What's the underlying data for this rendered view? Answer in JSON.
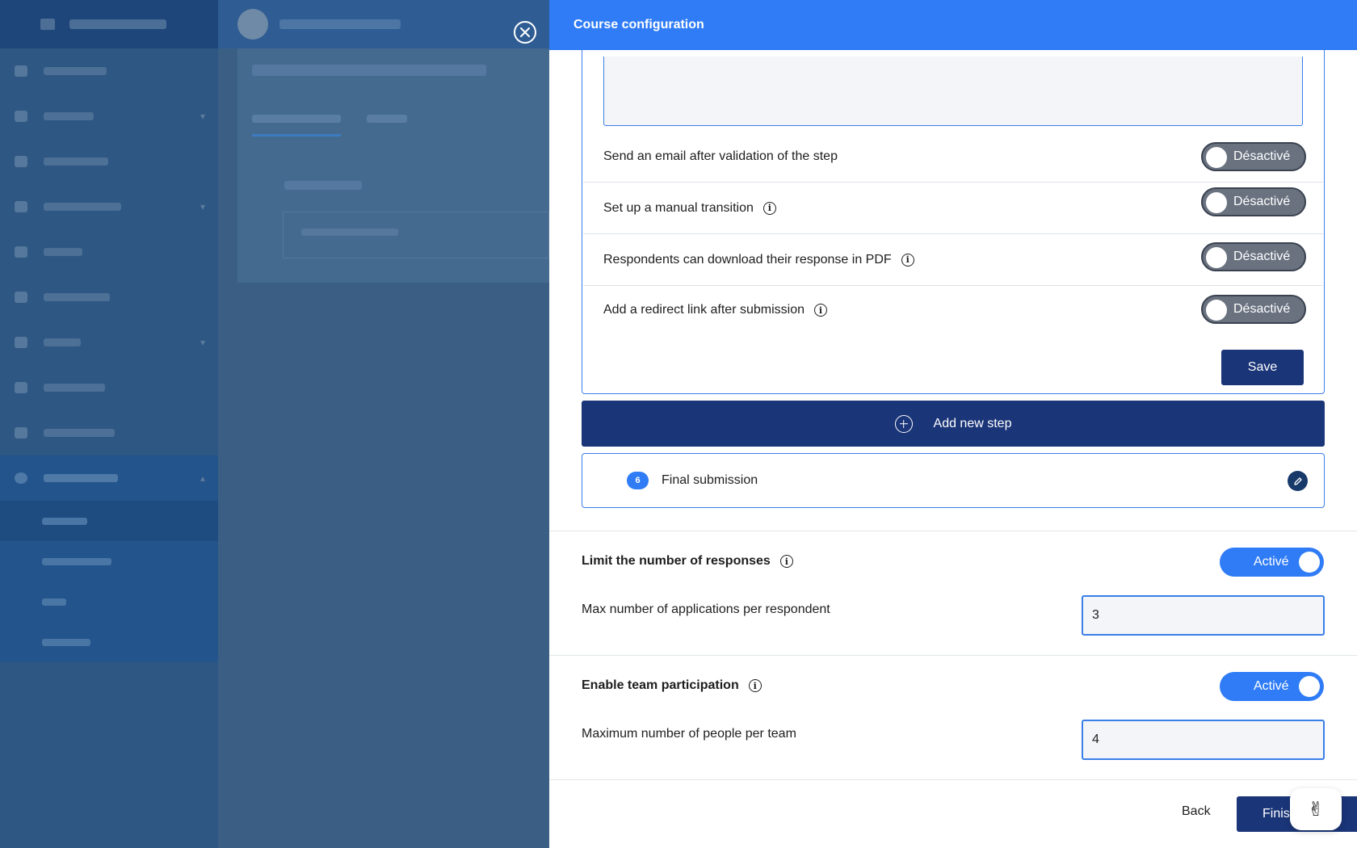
{
  "drawer": {
    "title": "Course configuration"
  },
  "step_options": [
    {
      "label": "Send an email after validation of the step",
      "toggle": "Désactivé",
      "info": false
    },
    {
      "label": "Set up a manual transition",
      "toggle": "Désactivé",
      "info": true
    },
    {
      "label": "Respondents can download their response in PDF",
      "toggle": "Désactivé",
      "info": true
    },
    {
      "label": "Add a redirect link after submission",
      "toggle": "Désactivé",
      "info": true
    }
  ],
  "save_label": "Save",
  "add_step_label": "Add new step",
  "final_step": {
    "number": "6",
    "label": "Final submission"
  },
  "limit_responses": {
    "title": "Limit the number of responses",
    "toggle": "Activé",
    "field_label": "Max number of applications per respondent",
    "value": "3"
  },
  "team": {
    "title": "Enable team participation",
    "toggle": "Activé",
    "field_label": "Maximum number of people per team",
    "value": "4"
  },
  "footer": {
    "back_label": "Back",
    "finish_label": "Finish"
  },
  "info_glyph": "i",
  "chat_icon": "✌"
}
